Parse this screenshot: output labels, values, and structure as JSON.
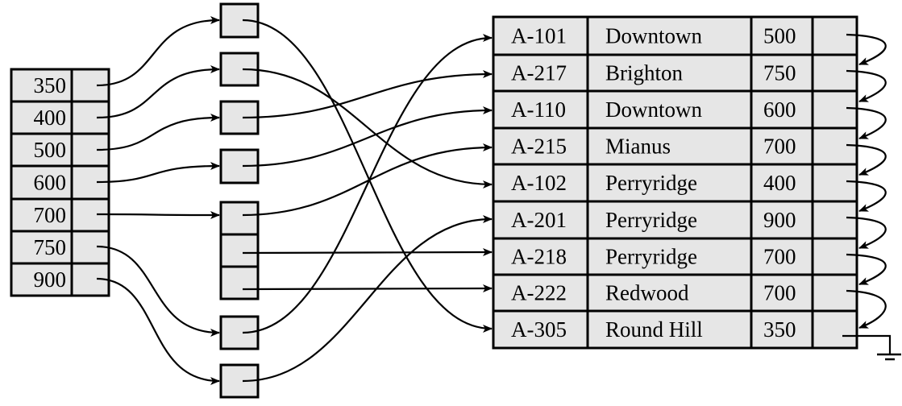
{
  "index": {
    "keys": [
      "350",
      "400",
      "500",
      "600",
      "700",
      "750",
      "900"
    ]
  },
  "relation": {
    "rows": [
      {
        "account": "A-101",
        "branch": "Downtown",
        "balance": "500"
      },
      {
        "account": "A-217",
        "branch": "Brighton",
        "balance": "750"
      },
      {
        "account": "A-110",
        "branch": "Downtown",
        "balance": "600"
      },
      {
        "account": "A-215",
        "branch": "Mianus",
        "balance": "700"
      },
      {
        "account": "A-102",
        "branch": "Perryridge",
        "balance": "400"
      },
      {
        "account": "A-201",
        "branch": "Perryridge",
        "balance": "900"
      },
      {
        "account": "A-218",
        "branch": "Perryridge",
        "balance": "700"
      },
      {
        "account": "A-222",
        "branch": "Redwood",
        "balance": "700"
      },
      {
        "account": "A-305",
        "branch": "Round Hill",
        "balance": "350"
      }
    ]
  },
  "colors": {
    "cell_fill": "#e6e6e6",
    "line": "#000000"
  }
}
